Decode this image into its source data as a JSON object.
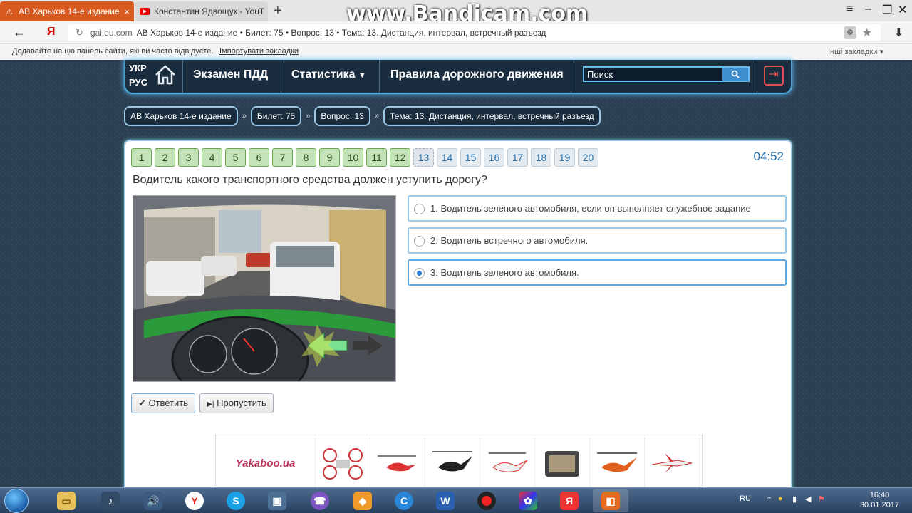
{
  "browser": {
    "tabs": [
      {
        "title": "АВ Харьков 14-е издание",
        "active": true
      },
      {
        "title": "Константин Ядвощук - YouT",
        "active": false
      }
    ],
    "new_tab": "+",
    "watermark": "www.Bandicam.com",
    "address": {
      "yandex": "Я",
      "domain": "gai.eu.com",
      "page_title": "АВ Харьков 14-е издание • Билет: 75 • Вопрос: 13 • Тема: 13. Дистанция, интервал, встречный разъезд"
    },
    "bookmarks": {
      "hint": "Додавайте на цю панель сайти, які ви часто відвідуєте.",
      "import": "Імпортувати закладки",
      "other": "Інші закладки"
    }
  },
  "site": {
    "lang_ukr": "УКР",
    "lang_rus": "РУС",
    "nav": [
      "Экзамен ПДД",
      "Статистика",
      "Правила дорожного движения"
    ],
    "search_placeholder": "Поиск",
    "breadcrumbs": [
      "АВ Харьков 14-е издание",
      "Билет: 75",
      "Вопрос: 13",
      "Тема: 13. Дистанция, интервал, встречный разъезд"
    ],
    "question_numbers": [
      {
        "n": "1",
        "state": "done"
      },
      {
        "n": "2",
        "state": "done"
      },
      {
        "n": "3",
        "state": "done"
      },
      {
        "n": "4",
        "state": "done"
      },
      {
        "n": "5",
        "state": "done"
      },
      {
        "n": "6",
        "state": "done"
      },
      {
        "n": "7",
        "state": "done"
      },
      {
        "n": "8",
        "state": "done"
      },
      {
        "n": "9",
        "state": "done"
      },
      {
        "n": "10",
        "state": "done"
      },
      {
        "n": "11",
        "state": "done"
      },
      {
        "n": "12",
        "state": "done"
      },
      {
        "n": "13",
        "state": "current"
      },
      {
        "n": "14",
        "state": "todo"
      },
      {
        "n": "15",
        "state": "todo"
      },
      {
        "n": "16",
        "state": "todo"
      },
      {
        "n": "17",
        "state": "todo"
      },
      {
        "n": "18",
        "state": "todo"
      },
      {
        "n": "19",
        "state": "todo"
      },
      {
        "n": "20",
        "state": "todo"
      }
    ],
    "timer": "04:52",
    "question": "Водитель какого транспортного средства должен уступить дорогу?",
    "answers": [
      {
        "text": "1. Водитель зеленого автомобиля, если он выполняет служебное задание",
        "selected": false
      },
      {
        "text": "2. Водитель встречного автомобиля.",
        "selected": false
      },
      {
        "text": "3. Водитель зеленого автомобиля.",
        "selected": true
      }
    ],
    "answer_button": "Ответить",
    "skip_button": "Пропустить",
    "ad_logo": "Yakaboo.ua"
  },
  "taskbar": {
    "language": "RU",
    "time": "16:40",
    "date": "30.01.2017"
  },
  "colors": {
    "accent": "#2a6ea8",
    "nav_bg": "#1a2d3f",
    "page_bg": "#2b3f52",
    "done": "#c4e3b9",
    "tab_active": "#d95a1f"
  }
}
